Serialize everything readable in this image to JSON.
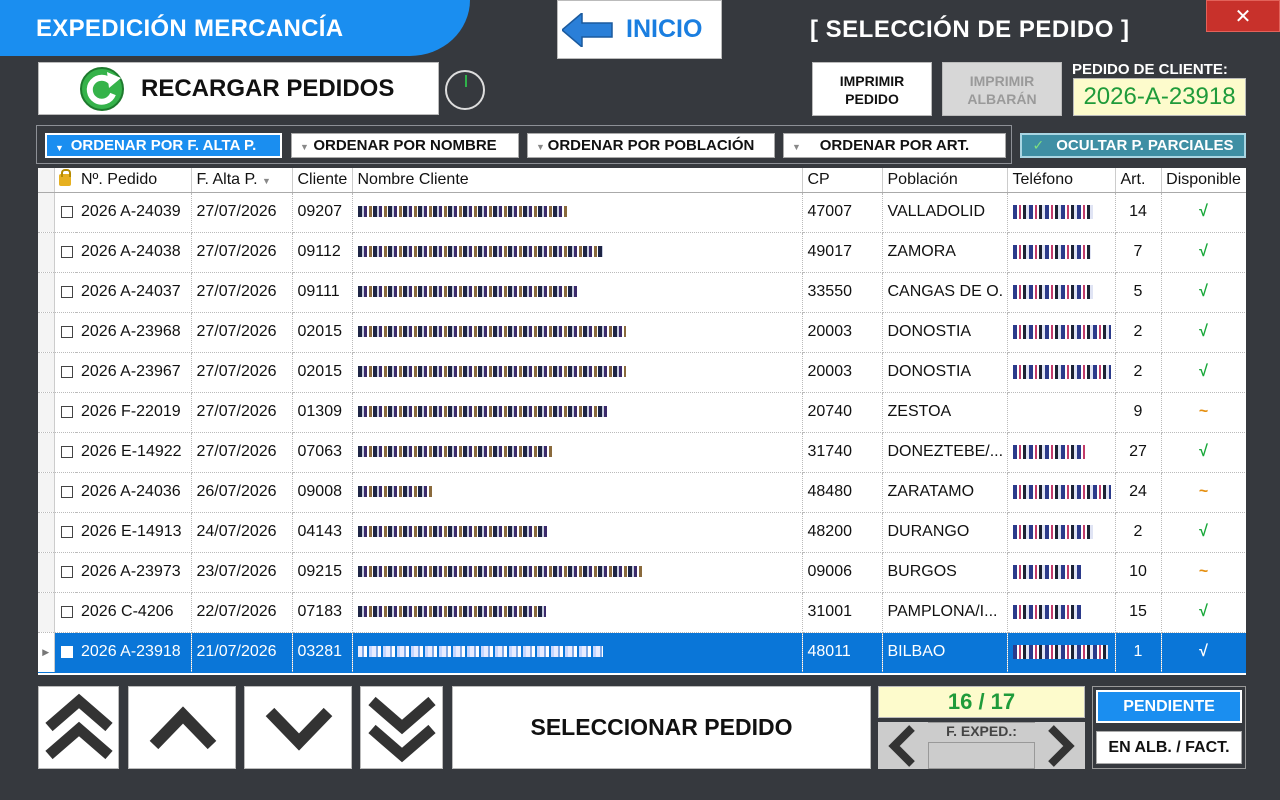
{
  "header": {
    "app_title": "EXPEDICIÓN MERCANCÍA",
    "home_label": "INICIO",
    "screen_title": "[ SELECCIÓN DE PEDIDO ]",
    "close_label": "✕",
    "reload_label": "RECARGAR PEDIDOS",
    "print_order_label": "IMPRIMIR PEDIDO",
    "print_delivery_label": "IMPRIMIR ALBARÁN",
    "client_order_label": "PEDIDO DE CLIENTE:",
    "client_order_value": "2026-A-23918"
  },
  "sort": {
    "by_date": "ORDENAR POR F. ALTA P.",
    "by_name": "ORDENAR POR NOMBRE",
    "by_town": "ORDENAR POR POBLACIÓN",
    "by_art": "ORDENAR POR ART.",
    "hide_partial": "OCULTAR P. PARCIALES"
  },
  "table": {
    "columns": [
      "Nº. Pedido",
      "F. Alta P.",
      "Cliente",
      "Nombre Cliente",
      "CP",
      "Población",
      "Teléfono",
      "Art.",
      "Disponible"
    ],
    "rows": [
      {
        "order": "2026 A-24039",
        "date": "27/07/2026",
        "client": "09207",
        "cp": "47007",
        "town": "VALLADOLID",
        "art": "14",
        "avail": "√",
        "kind": "ok",
        "nw": 210,
        "pw": 80
      },
      {
        "order": "2026 A-24038",
        "date": "27/07/2026",
        "client": "09112",
        "cp": "49017",
        "town": "ZAMORA",
        "art": "7",
        "avail": "√",
        "kind": "ok",
        "nw": 245,
        "pw": 78
      },
      {
        "order": "2026 A-24037",
        "date": "27/07/2026",
        "client": "09111",
        "cp": "33550",
        "town": "CANGAS DE O.",
        "art": "5",
        "avail": "√",
        "kind": "ok",
        "nw": 220,
        "pw": 80
      },
      {
        "order": "2026 A-23968",
        "date": "27/07/2026",
        "client": "02015",
        "cp": "20003",
        "town": "DONOSTIA",
        "art": "2",
        "avail": "√",
        "kind": "ok",
        "nw": 268,
        "pw": 98
      },
      {
        "order": "2026 A-23967",
        "date": "27/07/2026",
        "client": "02015",
        "cp": "20003",
        "town": "DONOSTIA",
        "art": "2",
        "avail": "√",
        "kind": "ok",
        "nw": 268,
        "pw": 98
      },
      {
        "order": "2026 F-22019",
        "date": "27/07/2026",
        "client": "01309",
        "cp": "20740",
        "town": "ZESTOA",
        "art": "9",
        "avail": "~",
        "kind": "part",
        "nw": 250,
        "pw": 0
      },
      {
        "order": "2026 E-14922",
        "date": "27/07/2026",
        "client": "07063",
        "cp": "31740",
        "town": "DONEZTEBE/...",
        "art": "27",
        "avail": "√",
        "kind": "ok",
        "nw": 195,
        "pw": 72
      },
      {
        "order": "2026 A-24036",
        "date": "26/07/2026",
        "client": "09008",
        "cp": "48480",
        "town": "ZARATAMO",
        "art": "24",
        "avail": "~",
        "kind": "part",
        "nw": 75,
        "pw": 98
      },
      {
        "order": "2026 E-14913",
        "date": "24/07/2026",
        "client": "04143",
        "cp": "48200",
        "town": "DURANGO",
        "art": "2",
        "avail": "√",
        "kind": "ok",
        "nw": 190,
        "pw": 80
      },
      {
        "order": "2026 A-23973",
        "date": "23/07/2026",
        "client": "09215",
        "cp": "09006",
        "town": "BURGOS",
        "art": "10",
        "avail": "~",
        "kind": "part",
        "nw": 285,
        "pw": 70
      },
      {
        "order": "2026 C-4206",
        "date": "22/07/2026",
        "client": "07183",
        "cp": "31001",
        "town": "PAMPLONA/I...",
        "art": "15",
        "avail": "√",
        "kind": "ok",
        "nw": 188,
        "pw": 70
      },
      {
        "order": "2026 A-23918",
        "date": "21/07/2026",
        "client": "03281",
        "cp": "48011",
        "town": "BILBAO",
        "art": "1",
        "avail": "√",
        "kind": "ok",
        "nw": 245,
        "pw": 95,
        "selected": true
      }
    ]
  },
  "footer": {
    "select_label": "SELECCIONAR PEDIDO",
    "counter": "16 / 17",
    "fexp_label": "F. EXPED.:",
    "pending_label": "PENDIENTE",
    "invoiced_label": "EN ALB. / FACT."
  },
  "colors": {
    "accent": "#1a8ef0",
    "ok": "#18a83a",
    "partial": "#e58f10",
    "close": "#c8312b"
  }
}
